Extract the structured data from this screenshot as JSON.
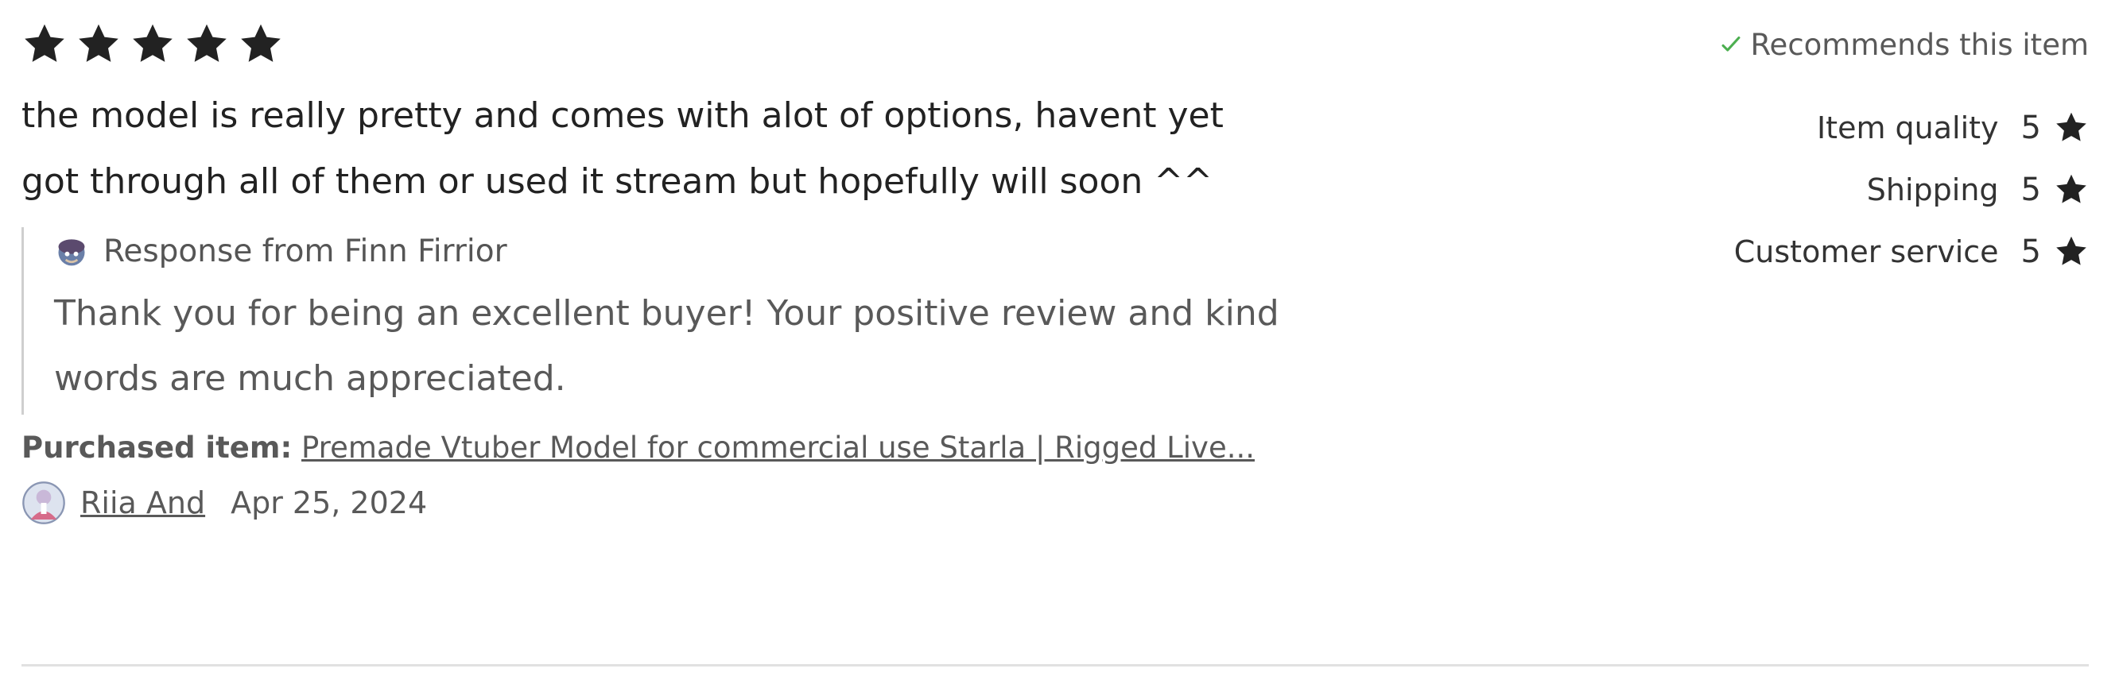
{
  "review": {
    "rating": 5,
    "max_rating": 5,
    "text": "the model is really pretty and comes with alot of options, havent yet got through all of them or used it stream but hopefully will soon ^^",
    "response": {
      "title": "Response from Finn Firrior",
      "text": "Thank you for being an excellent buyer! Your positive review and kind words are much appreciated."
    },
    "purchased_label": "Purchased item:",
    "purchased_item": "Premade Vtuber Model for commercial use Starla | Rigged Live...",
    "reviewer_name": "Riia And",
    "date": "Apr 25, 2024"
  },
  "sidebar": {
    "recommends": "Recommends this item",
    "ratings": [
      {
        "label": "Item quality",
        "value": "5"
      },
      {
        "label": "Shipping",
        "value": "5"
      },
      {
        "label": "Customer service",
        "value": "5"
      }
    ]
  },
  "colors": {
    "star": "#222222",
    "check": "#4caf50",
    "divider": "#e1e1e1"
  }
}
